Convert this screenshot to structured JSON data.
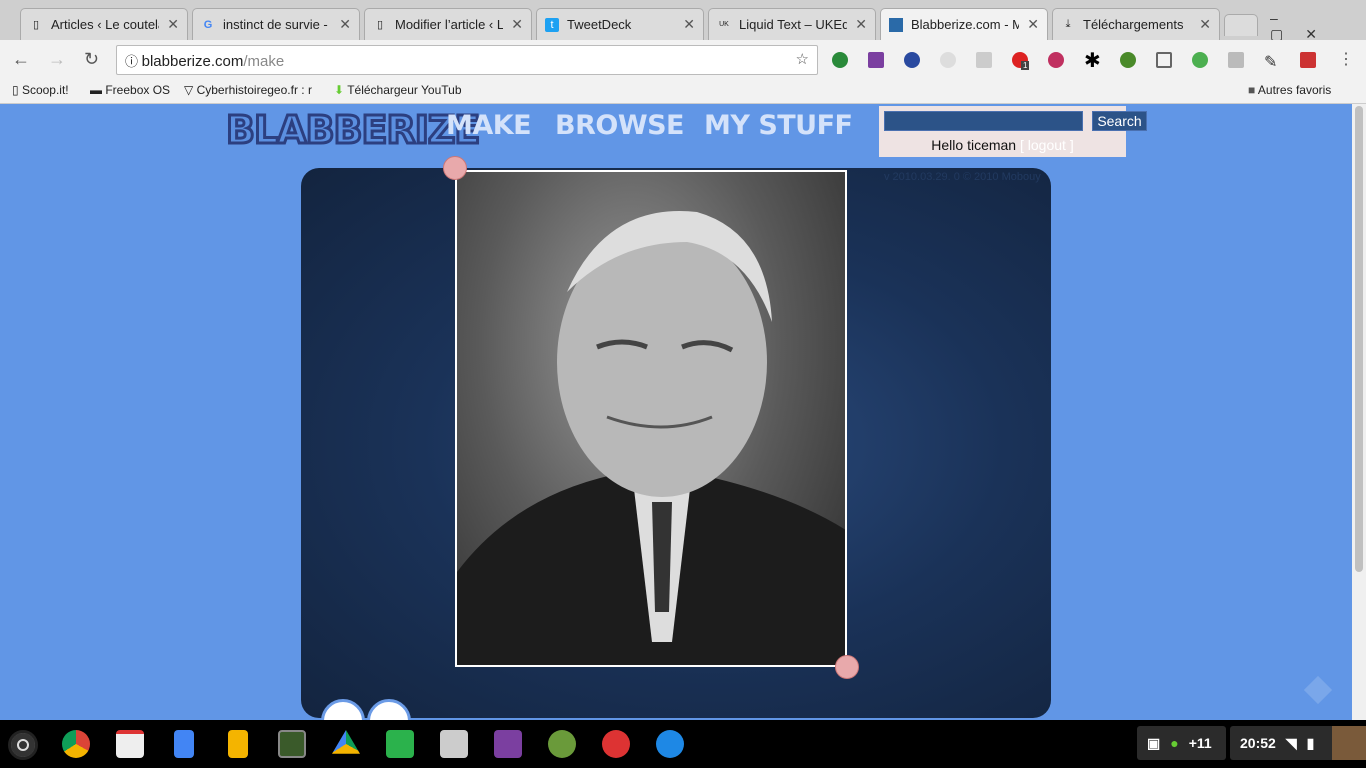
{
  "browser": {
    "tabs": [
      {
        "title": "Articles ‹ Le coutelas",
        "icon": "page-icon"
      },
      {
        "title": "instinct de survie - R",
        "icon": "google-icon"
      },
      {
        "title": "Modifier l’article ‹ Le",
        "icon": "page-icon"
      },
      {
        "title": "TweetDeck",
        "icon": "tweetdeck-icon"
      },
      {
        "title": "Liquid Text – UKEdC",
        "icon": "ukedchat-icon"
      },
      {
        "title": "Blabberize.com - Ma",
        "icon": "blabberize-icon",
        "active": true
      },
      {
        "title": "Téléchargements",
        "icon": "download-icon"
      }
    ],
    "url_host": "blabberize.com",
    "url_path": "/make",
    "bookmarks": [
      "Scoop.it!",
      "Freebox OS",
      "Cyberhistoiregeo.fr : r",
      "Téléchargeur YouTub"
    ],
    "other_bookmarks": "Autres favoris",
    "extension_badge": "1"
  },
  "site": {
    "logo": "BLABBERIZE",
    "nav": [
      "MAKE",
      "BROWSE",
      "MY STUFF"
    ],
    "search_button": "Search",
    "search_value": "",
    "hello": "Hello ticeman",
    "logout": "[ logout ]",
    "version": "v 2010.03.29. 0  © 2010 Mobouy"
  },
  "taskbar": {
    "notification_count": "+11",
    "time": "20:52"
  },
  "colors": {
    "page_bg": "#6196e6",
    "stage": "#13243f",
    "handle": "#e8a9ab",
    "nav_text": "#d4e2fa"
  }
}
